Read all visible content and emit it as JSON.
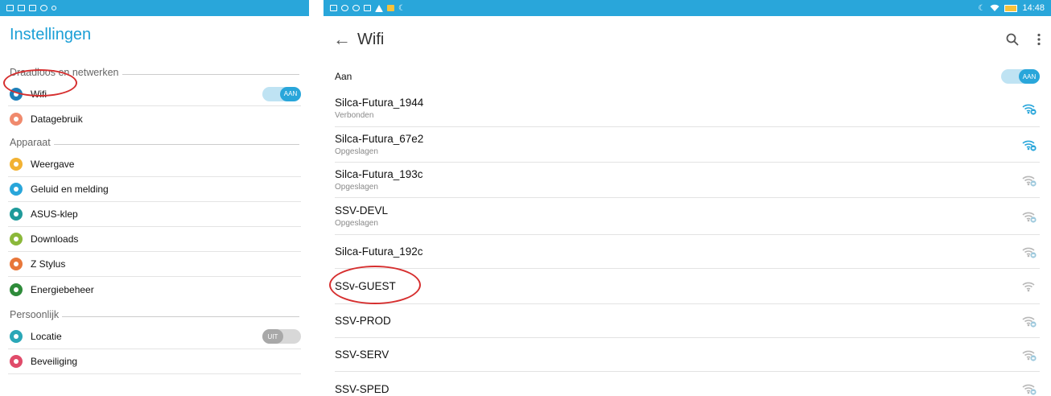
{
  "left": {
    "title": "Instellingen",
    "sections": [
      {
        "label": "Draadloos en netwerken"
      },
      {
        "label": "Apparaat"
      },
      {
        "label": "Persoonlijk"
      }
    ],
    "items": [
      {
        "label": "Wifi",
        "icon": "wifi-icon",
        "color": "#1e7fb8",
        "toggle": "AAN"
      },
      {
        "label": "Datagebruik",
        "icon": "data-usage-icon",
        "color": "#f08a6d"
      },
      {
        "label": "Weergave",
        "icon": "display-icon",
        "color": "#f2b233"
      },
      {
        "label": "Geluid en melding",
        "icon": "sound-icon",
        "color": "#29a6da"
      },
      {
        "label": "ASUS-klep",
        "icon": "cover-icon",
        "color": "#1f9a9a"
      },
      {
        "label": "Downloads",
        "icon": "download-icon",
        "color": "#8bb83a"
      },
      {
        "label": "Z Stylus",
        "icon": "stylus-icon",
        "color": "#e8773a"
      },
      {
        "label": "Energiebeheer",
        "icon": "power-icon",
        "color": "#2e8b3a"
      },
      {
        "label": "Locatie",
        "icon": "location-icon",
        "color": "#2aa7b7",
        "toggle": "UIT"
      },
      {
        "label": "Beveiliging",
        "icon": "lock-icon",
        "color": "#e04b6a"
      }
    ]
  },
  "right": {
    "status_time": "14:48",
    "title": "Wifi",
    "master": {
      "label": "Aan",
      "toggle": "AAN"
    },
    "networks": [
      {
        "name": "Silca-Futura_1944",
        "status": "Verbonden",
        "signal": "strong-locked"
      },
      {
        "name": "Silca-Futura_67e2",
        "status": "Opgeslagen",
        "signal": "strong-locked"
      },
      {
        "name": "Silca-Futura_193c",
        "status": "Opgeslagen",
        "signal": "weak-locked"
      },
      {
        "name": "SSV-DEVL",
        "status": "Opgeslagen",
        "signal": "weak-locked"
      },
      {
        "name": "Silca-Futura_192c",
        "status": "",
        "signal": "weak-locked"
      },
      {
        "name": "SSv-GUEST",
        "status": "",
        "signal": "weak-open"
      },
      {
        "name": "SSV-PROD",
        "status": "",
        "signal": "weak-locked"
      },
      {
        "name": "SSV-SERV",
        "status": "",
        "signal": "weak-locked"
      },
      {
        "name": "SSV-SPED",
        "status": "",
        "signal": "weak-locked"
      }
    ]
  },
  "colors": {
    "accent": "#29a6da",
    "highlight_oval": "#d62f2f"
  }
}
